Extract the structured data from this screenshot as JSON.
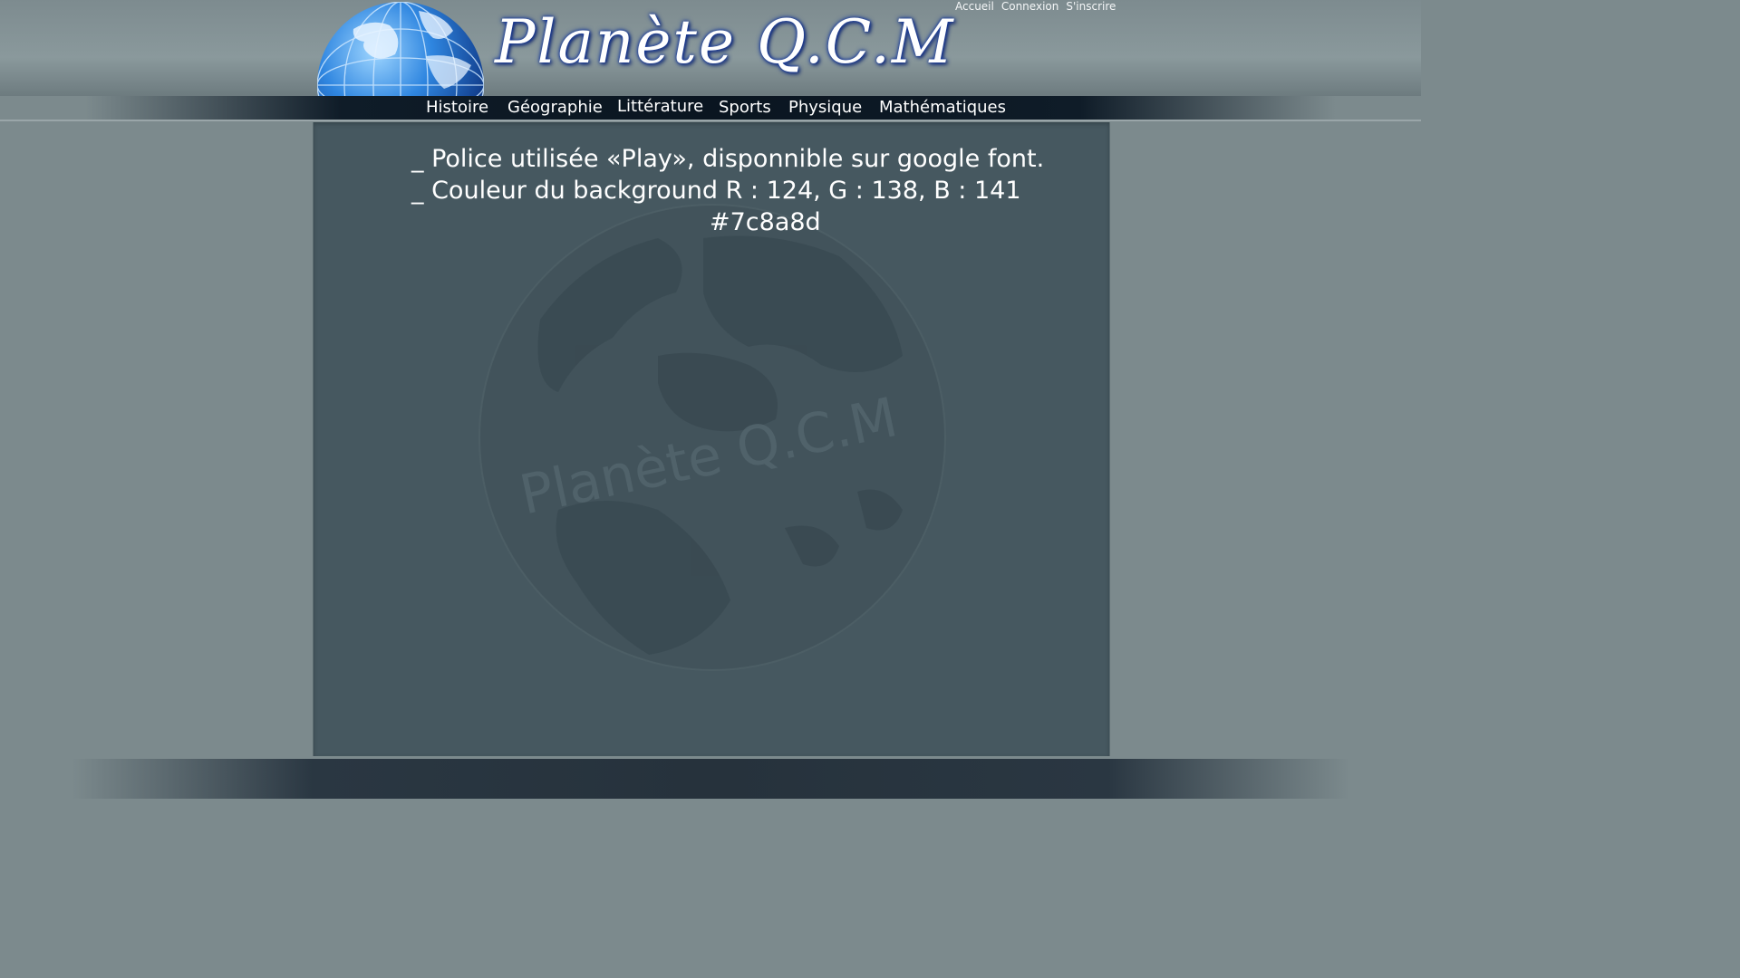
{
  "header": {
    "site_title": "Planète Q.C.M",
    "top_links": [
      "Accueil",
      "Connexion",
      "S'inscrire"
    ]
  },
  "nav": {
    "items": [
      "Histoire",
      "Géographie",
      "Littérature",
      "Sports",
      "Physique",
      "Mathématiques"
    ]
  },
  "main": {
    "lines": [
      "_ Police utilisée «Play», disponnible sur google font.",
      "_ Couleur du background R : 124, G : 138, B : 141",
      "#7c8a8d"
    ],
    "watermark_text": "Planète Q.C.M"
  },
  "colors": {
    "background": "#7c8a8d",
    "content_panel": "#465860",
    "title_glow": "#1a3c9c"
  },
  "icons": {
    "logo": "globe-icon",
    "watermark": "globe-watermark"
  }
}
